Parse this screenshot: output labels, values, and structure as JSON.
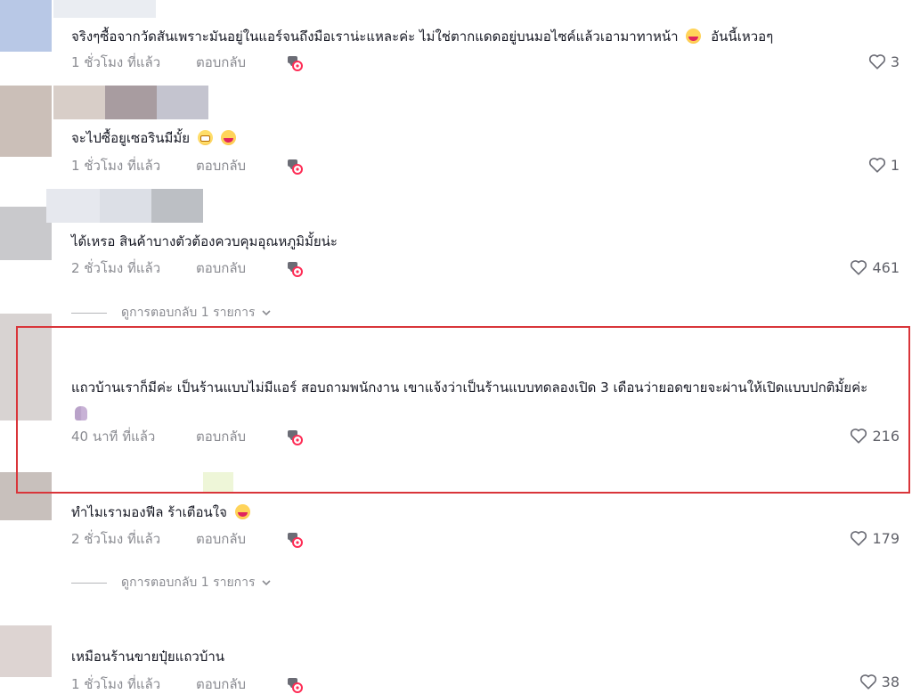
{
  "comments": [
    {
      "text": "จริงๆซื้อจากวัดสันเพราะมันอยู่ในแอร์จนถึงมือเราน่ะแหละค่ะ ไม่ใช่ตากแดดอยู่บนมอไซค์แล้วเอามาทาหน้า",
      "text_tail": "อันนี้เหวอๆ",
      "time": "1 ชั่วโมง ที่แล้ว",
      "reply": "ตอบกลับ",
      "likes": "3"
    },
    {
      "text": "จะไปซื้อยูเซอรินมีมั้ย",
      "time": "1 ชั่วโมง ที่แล้ว",
      "reply": "ตอบกลับ",
      "likes": "1"
    },
    {
      "text": "ได้เหรอ สินค้าบางตัวต้องควบคุมอุณหภูมิมั้ยน่ะ",
      "time": "2 ชั่วโมง ที่แล้ว",
      "reply": "ตอบกลับ",
      "likes": "461",
      "view_replies": "ดูการตอบกลับ 1 รายการ"
    },
    {
      "text": "แถวบ้านเราก็มีค่ะ เป็นร้านแบบไม่มีแอร์ สอบถามพนักงาน เขาแจ้งว่าเป็นร้านแบบทดลองเปิด 3 เดือนว่ายอดขายจะผ่านให้เปิดแบบปกติมั้ยค่ะ",
      "time": "40 นาที ที่แล้ว",
      "reply": "ตอบกลับ",
      "likes": "216"
    },
    {
      "text": "ทำไมเรามองฟีล ร้าเตือนใจ",
      "time": "2 ชั่วโมง ที่แล้ว",
      "reply": "ตอบกลับ",
      "likes": "179",
      "view_replies": "ดูการตอบกลับ 1 รายการ"
    },
    {
      "text": "เหมือนร้านขายปุ๋ยแถวบ้าน",
      "time": "1 ชั่วโมง ที่แล้ว",
      "reply": "ตอบกลับ",
      "likes": "38"
    }
  ],
  "icons": {
    "like": "heart-outline-icon",
    "create": "create-video-icon",
    "chevron": "chevron-down-icon"
  },
  "colors": {
    "highlight_border": "#d9353a",
    "meta_text": "#8a8b91",
    "body_text": "#161823"
  }
}
